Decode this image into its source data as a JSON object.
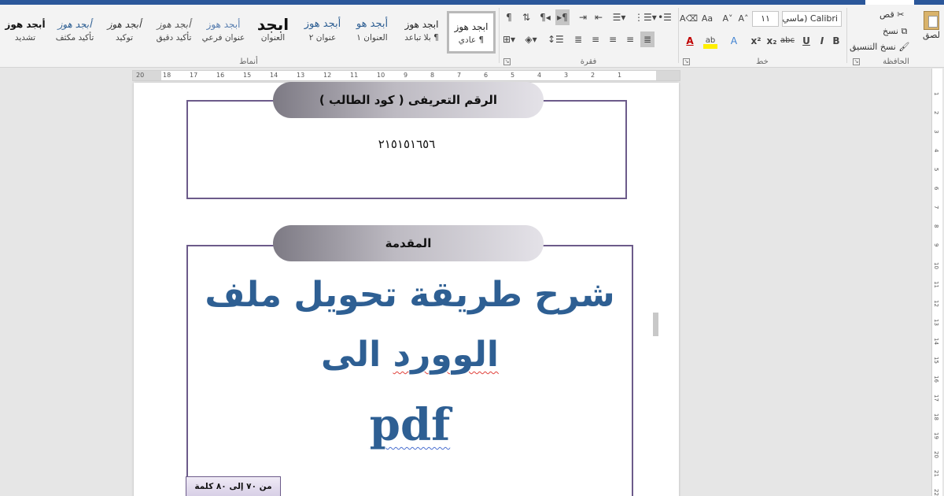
{
  "colors": {
    "title_bar": "#2b579a",
    "heading_text": "#2e5f93",
    "frame_border": "#6c5b8a",
    "spell_error": "#e0403a"
  },
  "ribbon": {
    "styles_group": {
      "label": "أنماط",
      "tiles": [
        {
          "sample": "ابجد هوز",
          "name": "¶ عادي",
          "selected": true
        },
        {
          "sample": "ابجد هوز",
          "name": "¶ بلا تباعد"
        },
        {
          "sample": "أبجد هو",
          "name": "العنوان ١"
        },
        {
          "sample": "أبجد هوز",
          "name": "عنوان ٢"
        },
        {
          "sample": "ابجد",
          "name": "العنوان"
        },
        {
          "sample": "أبجد هوز",
          "name": "عنوان فرعي"
        },
        {
          "sample": "أبجد هوز",
          "name": "تأكيد دقيق"
        },
        {
          "sample": "أبجد هوز",
          "name": "توكيد"
        },
        {
          "sample": "أبجد هوز",
          "name": "تأكيد مكثف"
        },
        {
          "sample": "أبجد هوز",
          "name": "تشديد"
        }
      ]
    },
    "paragraph_group": {
      "label": "فقرة"
    },
    "font_group": {
      "label": "خط",
      "font_name": "Calibri (ماسي)",
      "font_size": "١١",
      "bold": "B",
      "italic": "I",
      "underline": "U",
      "strike": "abc",
      "subscript": "x₂",
      "superscript": "x²",
      "font_color_icon": "A",
      "highlight_icon": "ab",
      "grow": "A˄",
      "shrink": "A˅",
      "case": "Aa"
    },
    "clipboard_group": {
      "label": "الحافظة",
      "paste": "لصق",
      "cut": "قص",
      "copy": "نسخ",
      "format_painter": "نسخ التنسيق"
    }
  },
  "document": {
    "id_box": {
      "title": "الرقم التعريفى ( كود الطالب )",
      "code": "٢١٥١٥١٦٥٦"
    },
    "intro_box": {
      "title": "المقدمة",
      "heading_line1": "شرح طريقة تحويل ملف",
      "heading_line2_a": "الوورد",
      "heading_line2_b": "الى",
      "heading_line3": "pdf",
      "word_count_note": "من ٧٠ إلى ٨٠ كلمة"
    }
  },
  "ruler_numbers": [
    "20",
    "18",
    "17",
    "16",
    "15",
    "14",
    "13",
    "12",
    "11",
    "10",
    "9",
    "8",
    "7",
    "6",
    "5",
    "4",
    "3",
    "2",
    "1"
  ],
  "v_ruler_numbers": [
    "1",
    "2",
    "3",
    "4",
    "5",
    "6",
    "7",
    "8",
    "9",
    "10",
    "11",
    "12",
    "13",
    "14",
    "15",
    "16",
    "17",
    "18",
    "19",
    "20",
    "21",
    "22"
  ]
}
